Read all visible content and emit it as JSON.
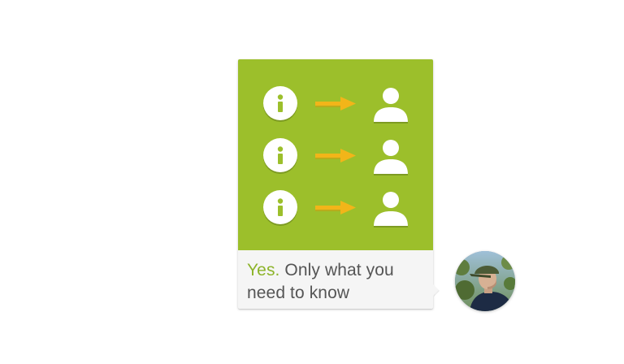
{
  "message": {
    "highlight": "Yes.",
    "text": " Only what you need to know"
  },
  "illustration": {
    "rows": [
      {
        "left_icon": "info-icon",
        "middle_icon": "arrow-right-icon",
        "right_icon": "person-icon"
      },
      {
        "left_icon": "info-icon",
        "middle_icon": "arrow-right-icon",
        "right_icon": "person-icon"
      },
      {
        "left_icon": "info-icon",
        "middle_icon": "arrow-right-icon",
        "right_icon": "person-icon"
      }
    ]
  },
  "colors": {
    "panel_green": "#9cbf2b",
    "arrow_orange": "#f2b519",
    "accent_text": "#8db42a",
    "body_text": "#555555",
    "bubble_bg": "#f5f5f5"
  },
  "avatar": {
    "kind": "user-photo"
  }
}
